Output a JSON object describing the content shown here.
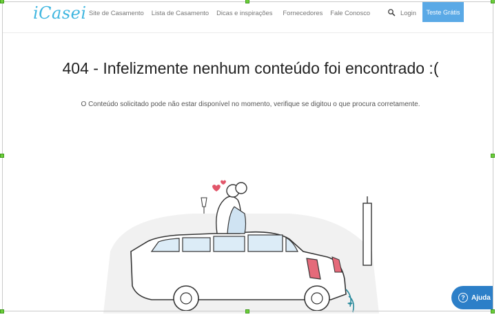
{
  "header": {
    "logo": "iCasei",
    "nav": [
      {
        "label": "Site de Casamento"
      },
      {
        "label": "Lista de Casamento"
      },
      {
        "label": "Dicas e inspirações"
      },
      {
        "label": "Fornecedores"
      },
      {
        "label": "Fale Conosco"
      }
    ],
    "login_label": "Login",
    "cta_label": "Teste Grátis"
  },
  "main": {
    "title": "404 - Infelizmente nenhum conteúdo foi encontrado :(",
    "subtitle": "O Conteúdo solicitado pode não estar disponível no momento, verifique se digitou o que procura corretamente."
  },
  "help": {
    "icon_glyph": "?",
    "label": "Ajuda"
  },
  "colors": {
    "brand": "#3fb6e0",
    "cta": "#5aa9e6",
    "help": "#2c7fc8"
  }
}
